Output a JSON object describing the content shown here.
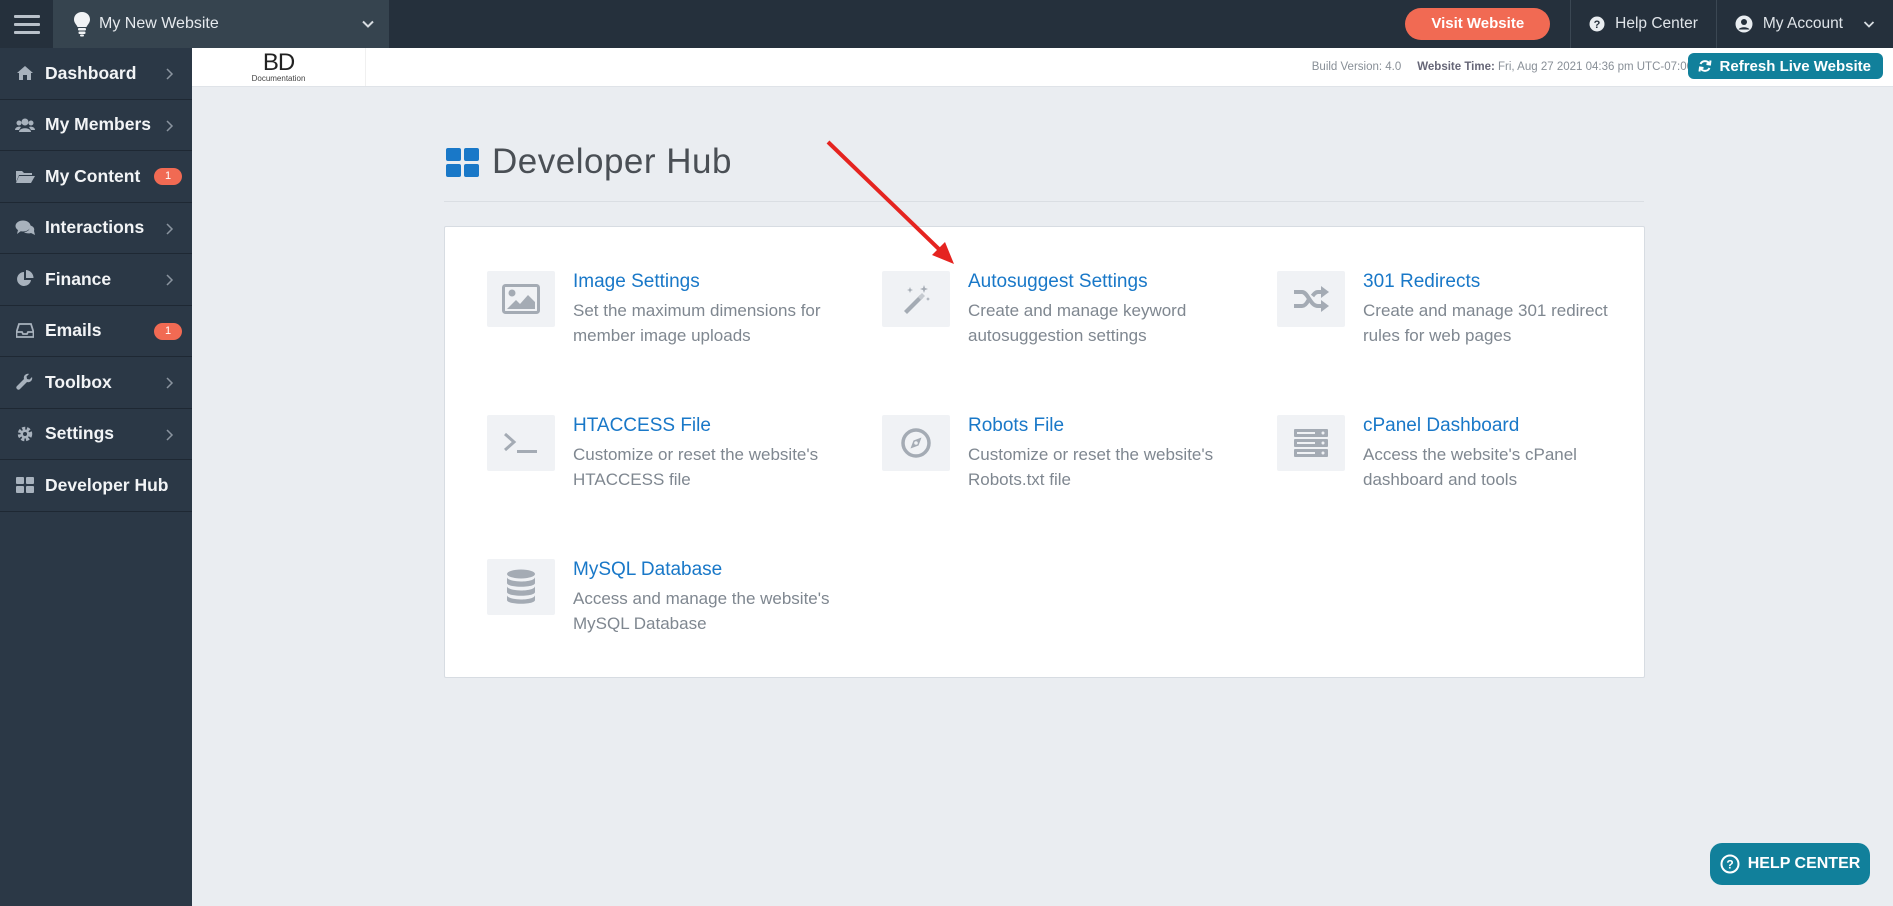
{
  "topbar": {
    "site_name": "My New Website",
    "visit_label": "Visit Website",
    "help_label": "Help Center",
    "account_label": "My Account"
  },
  "sidebar": {
    "items": [
      {
        "label": "Dashboard",
        "icon": "home-icon"
      },
      {
        "label": "My Members",
        "icon": "users-icon"
      },
      {
        "label": "My Content",
        "icon": "folder-icon",
        "badge": "1"
      },
      {
        "label": "Interactions",
        "icon": "comments-icon"
      },
      {
        "label": "Finance",
        "icon": "pie-chart-icon"
      },
      {
        "label": "Emails",
        "icon": "inbox-icon",
        "badge": "1"
      },
      {
        "label": "Toolbox",
        "icon": "wrench-icon"
      },
      {
        "label": "Settings",
        "icon": "gear-icon"
      },
      {
        "label": "Developer Hub",
        "icon": "grid-icon"
      }
    ]
  },
  "subheader": {
    "logo_text": "BD",
    "logo_sub": "Documentation",
    "build_label": "Build Version:",
    "build_value": "4.0",
    "time_label": "Website Time:",
    "time_value": "Fri, Aug 27 2021 04:36 pm UTC-07:00",
    "refresh_label": "Refresh Live Website"
  },
  "page": {
    "title": "Developer Hub"
  },
  "tiles": [
    {
      "title": "Image Settings",
      "desc": "Set the maximum dimensions for member image uploads",
      "icon": "image-icon"
    },
    {
      "title": "Autosuggest Settings",
      "desc": "Create and manage keyword autosuggestion settings",
      "icon": "magic-wand-icon"
    },
    {
      "title": "301 Redirects",
      "desc": "Create and manage 301 redirect rules for web pages",
      "icon": "shuffle-icon"
    },
    {
      "title": "HTACCESS File",
      "desc": "Customize or reset the website's HTACCESS file",
      "icon": "terminal-icon"
    },
    {
      "title": "Robots File",
      "desc": "Customize or reset the website's Robots.txt file",
      "icon": "compass-icon"
    },
    {
      "title": "cPanel Dashboard",
      "desc": "Access the website's cPanel dashboard and tools",
      "icon": "server-icon"
    },
    {
      "title": "MySQL Database",
      "desc": "Access and manage the website's MySQL Database",
      "icon": "database-icon"
    }
  ],
  "help_float": {
    "label": "HELP CENTER"
  },
  "colors": {
    "sidebar_bg": "#2b3846",
    "topbar_bg": "#25303c",
    "accent_orange": "#f16a53",
    "accent_teal": "#11809b",
    "link_blue": "#1978c8",
    "annotation_red": "#e52420"
  }
}
